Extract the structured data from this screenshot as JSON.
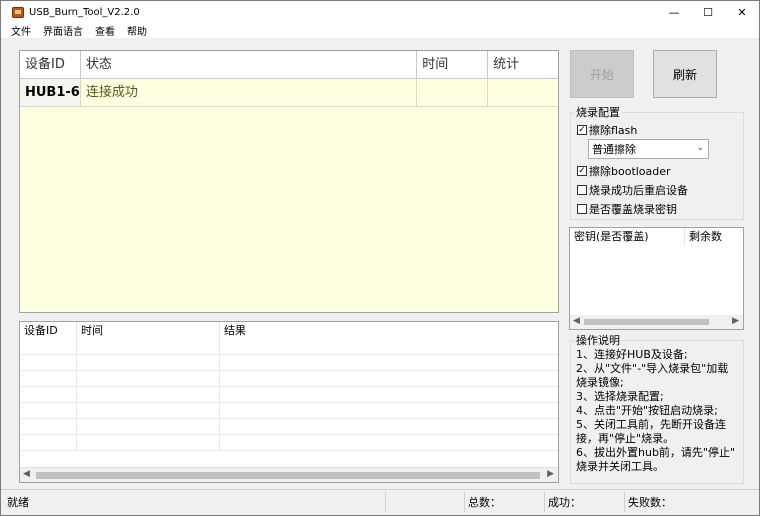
{
  "window": {
    "title": "USB_Burn_Tool_V2.2.0",
    "minimize_glyph": "—",
    "maximize_glyph": "☐",
    "close_glyph": "✕"
  },
  "menu": {
    "items": [
      "文件",
      "界面语言",
      "查看",
      "帮助"
    ]
  },
  "device_table": {
    "headers": [
      "设备ID",
      "状态",
      "时间",
      "统计"
    ],
    "rows": [
      {
        "device_id": "HUB1-6",
        "status": "连接成功",
        "time": "",
        "stats": ""
      }
    ]
  },
  "buttons": {
    "start": "开始",
    "refresh": "刷新"
  },
  "burn_config": {
    "label": "烧录配置",
    "erase_flash": {
      "label": "擦除flash",
      "checked": true
    },
    "erase_mode": {
      "selected": "普通擦除"
    },
    "erase_bootloader": {
      "label": "擦除bootloader",
      "checked": true
    },
    "reboot_after_success": {
      "label": "烧录成功后重启设备",
      "checked": false
    },
    "overwrite_key": {
      "label": "是否覆盖烧录密钥",
      "checked": false
    }
  },
  "key_table": {
    "headers": [
      "密钥(是否覆盖)",
      "剩余数"
    ]
  },
  "log_table": {
    "headers": [
      "设备ID",
      "时间",
      "结果"
    ]
  },
  "instructions": {
    "label": "操作说明",
    "lines": [
      "1、连接好HUB及设备;",
      "2、从\"文件\"-\"导入烧录包\"加载",
      "烧录镜像;",
      "3、选择烧录配置;",
      "4、点击\"开始\"按钮启动烧录;",
      "5、关闭工具前，先断开设备连",
      "接，再\"停止\"烧录。",
      "6、拔出外置hub前，请先\"停止\"",
      "烧录并关闭工具。"
    ]
  },
  "statusbar": {
    "state": "就绪",
    "total_label": "总数：",
    "success_label": "成功：",
    "fail_label": "失败数："
  },
  "icons": {
    "app": "app-icon",
    "scroll_left": "scroll-left-icon",
    "scroll_right": "scroll-right-icon",
    "dropdown": "chevron-down-icon"
  }
}
